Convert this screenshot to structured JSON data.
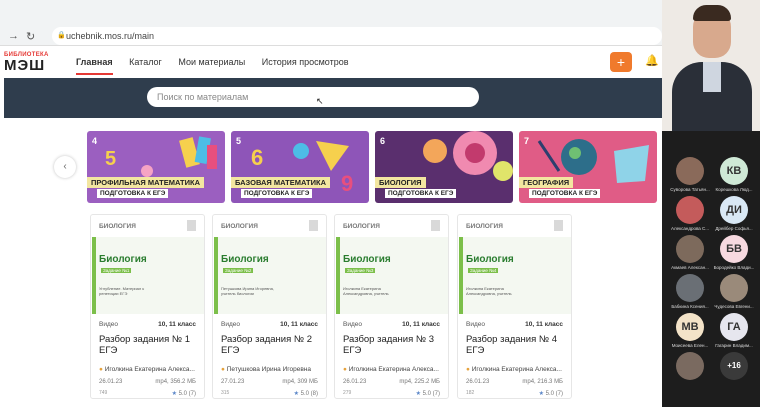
{
  "browser": {
    "url": "uchebnik.mos.ru/main"
  },
  "app": {
    "logo_small": "БИБЛИОТЕКА",
    "logo_big": "МЭШ",
    "menu": [
      "Главная",
      "Каталог",
      "Мои материалы",
      "История просмотров"
    ],
    "plus_label": "+",
    "search_placeholder": "Поиск по материалам"
  },
  "banners": [
    {
      "num": "4",
      "title": "ПРОФИЛЬНАЯ МАТЕМАТИКА",
      "subtitle": "ПОДГОТОВКА К ЕГЭ",
      "color": "#9b5fc0"
    },
    {
      "num": "5",
      "title": "БАЗОВАЯ МАТЕМАТИКА",
      "subtitle": "ПОДГОТОВКА К ЕГЭ",
      "color": "#8e55b8"
    },
    {
      "num": "6",
      "title": "БИОЛОГИЯ",
      "subtitle": "ПОДГОТОВКА К ЕГЭ",
      "color": "#5a2f6e"
    },
    {
      "num": "7",
      "title": "ГЕОГРАФИЯ",
      "subtitle": "ПОДГОТОВКА К ЕГЭ",
      "color": "#e05c86"
    }
  ],
  "cards": [
    {
      "subject": "БИОЛОГИЯ",
      "cover_title": "Биология",
      "cover_tag": "Задание №1",
      "cover_author": "Углубление. Материал к репетиции ЕГЭ",
      "type": "Видео",
      "grade": "10, 11 класс",
      "title": "Разбор задания № 1 ЕГЭ",
      "author": "Иголкина Екатерина Алекса...",
      "date": "26.01.23",
      "size": "mp4, 356.2 МБ",
      "views": "749",
      "rating": "5.0 (7)"
    },
    {
      "subject": "БИОЛОГИЯ",
      "cover_title": "Биология",
      "cover_tag": "Задание №2",
      "cover_author": "Петушкова Ирина Игоревна, учитель биологии",
      "type": "Видео",
      "grade": "10, 11 класс",
      "title": "Разбор задания № 2 ЕГЭ",
      "author": "Петушкова Ирина Игоревна",
      "date": "27.01.23",
      "size": "mp4, 309 МБ",
      "views": "315",
      "rating": "5.0 (8)"
    },
    {
      "subject": "БИОЛОГИЯ",
      "cover_title": "Биология",
      "cover_tag": "Задание №3",
      "cover_author": "Иголкина Екатерина Александровна, учитель",
      "type": "Видео",
      "grade": "10, 11 класс",
      "title": "Разбор задания № 3 ЕГЭ",
      "author": "Иголкина Екатерина Алекса...",
      "date": "26.01.23",
      "size": "mp4, 225.2 МБ",
      "views": "279",
      "rating": "5.0 (7)"
    },
    {
      "subject": "БИОЛОГИЯ",
      "cover_title": "Биология",
      "cover_tag": "Задание №4",
      "cover_author": "Иголкина Екатерина Александровна, учитель",
      "type": "Видео",
      "grade": "10, 11 класс",
      "title": "Разбор задания № 4 ЕГЭ",
      "author": "Иголкина Екатерина Алекса...",
      "date": "26.01.23",
      "size": "mp4, 216.3 МБ",
      "views": "182",
      "rating": "5.0 (7)"
    }
  ],
  "participants": [
    {
      "initials": "",
      "name": "Суворова Татьян...",
      "bg": "#8a6a5a",
      "photo": true
    },
    {
      "initials": "КВ",
      "name": "Корешкова Люд...",
      "bg": "#cfe9d6"
    },
    {
      "initials": "",
      "name": "Александрова С...",
      "bg": "#c45b5b",
      "photo": true
    },
    {
      "initials": "ДИ",
      "name": "Дрейбер Софья...",
      "bg": "#d9e8f5"
    },
    {
      "initials": "",
      "name": "Акмаев Алексан...",
      "bg": "#7d6a5c",
      "photo": true
    },
    {
      "initials": "БВ",
      "name": "Бородейко Влади...",
      "bg": "#f7d9e0"
    },
    {
      "initials": "",
      "name": "Бабкина Ксения...",
      "bg": "#6a6f75",
      "photo": true
    },
    {
      "initials": "",
      "name": "Чудесова Евгени...",
      "bg": "#9a8a7a",
      "photo": true
    },
    {
      "initials": "МВ",
      "name": "Моисеева Елен...",
      "bg": "#f3e3c8"
    },
    {
      "initials": "ГА",
      "name": "Гагарин Владим...",
      "bg": "#e6e6ee"
    },
    {
      "initials": "",
      "name": "",
      "bg": "#7a6a60",
      "photo": true
    },
    {
      "initials": "+16",
      "name": "",
      "bg": "#3a3a3a"
    }
  ]
}
